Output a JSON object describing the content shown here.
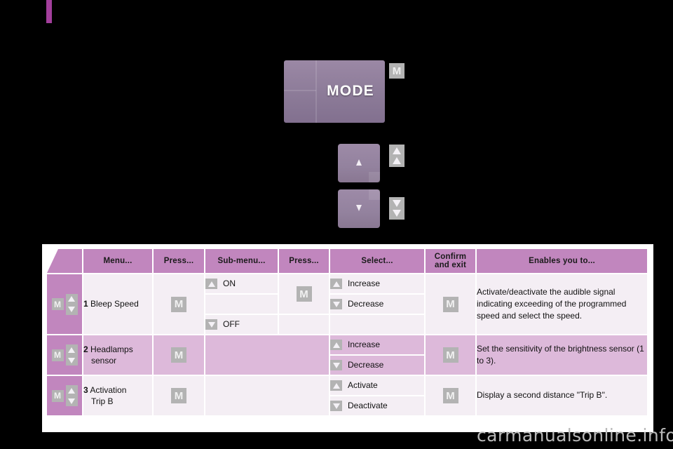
{
  "illustration": {
    "mode_button_label": "MODE",
    "callout_mode": "M",
    "callout_up": "up-arrow",
    "callout_down": "down-arrow"
  },
  "table": {
    "headers": [
      "Menu...",
      "Press...",
      "Sub-menu...",
      "Press...",
      "Select...",
      "Confirm and exit",
      "Enables you to..."
    ],
    "header_confirm_line1": "Confirm",
    "header_confirm_line2": "and exit",
    "rows": [
      {
        "number": "1",
        "menu_line1": "Bleep Speed",
        "menu_line2": "",
        "press_key": "M",
        "submenus": [
          {
            "arrow": "up",
            "label": "ON"
          },
          {
            "arrow": "",
            "label": ""
          },
          {
            "arrow": "down",
            "label": "OFF"
          }
        ],
        "press2_key": "M",
        "selects": [
          {
            "arrow": "up",
            "label": "Increase"
          },
          {
            "arrow": "down",
            "label": "Decrease"
          }
        ],
        "confirm_key": "M",
        "description": "Activate/deactivate the audible signal indicating exceeding of the programmed speed and select the speed."
      },
      {
        "number": "2",
        "menu_line1": "Headlamps",
        "menu_line2": "sensor",
        "press_key": "M",
        "submenus": [],
        "press2_key": "",
        "selects": [
          {
            "arrow": "up",
            "label": "Increase"
          },
          {
            "arrow": "down",
            "label": "Decrease"
          }
        ],
        "confirm_key": "M",
        "description": "Set the sensitivity of the brightness sensor (1 to 3)."
      },
      {
        "number": "3",
        "menu_line1": "Activation",
        "menu_line2": "Trip B",
        "press_key": "M",
        "submenus": [],
        "press2_key": "",
        "selects": [
          {
            "arrow": "up",
            "label": "Activate"
          },
          {
            "arrow": "down",
            "label": "Deactivate"
          }
        ],
        "confirm_key": "M",
        "description": "Display a second distance \"Trip B\"."
      }
    ],
    "row_key_glyph": "M"
  },
  "watermark": "carmanualsonline.info",
  "colors": {
    "header_purple": "#c186be",
    "accent_tab": "#a33f9c",
    "row_light": "#f4eef4",
    "row_alt": "#ddb9da",
    "key_grey": "#b3b3b3"
  }
}
